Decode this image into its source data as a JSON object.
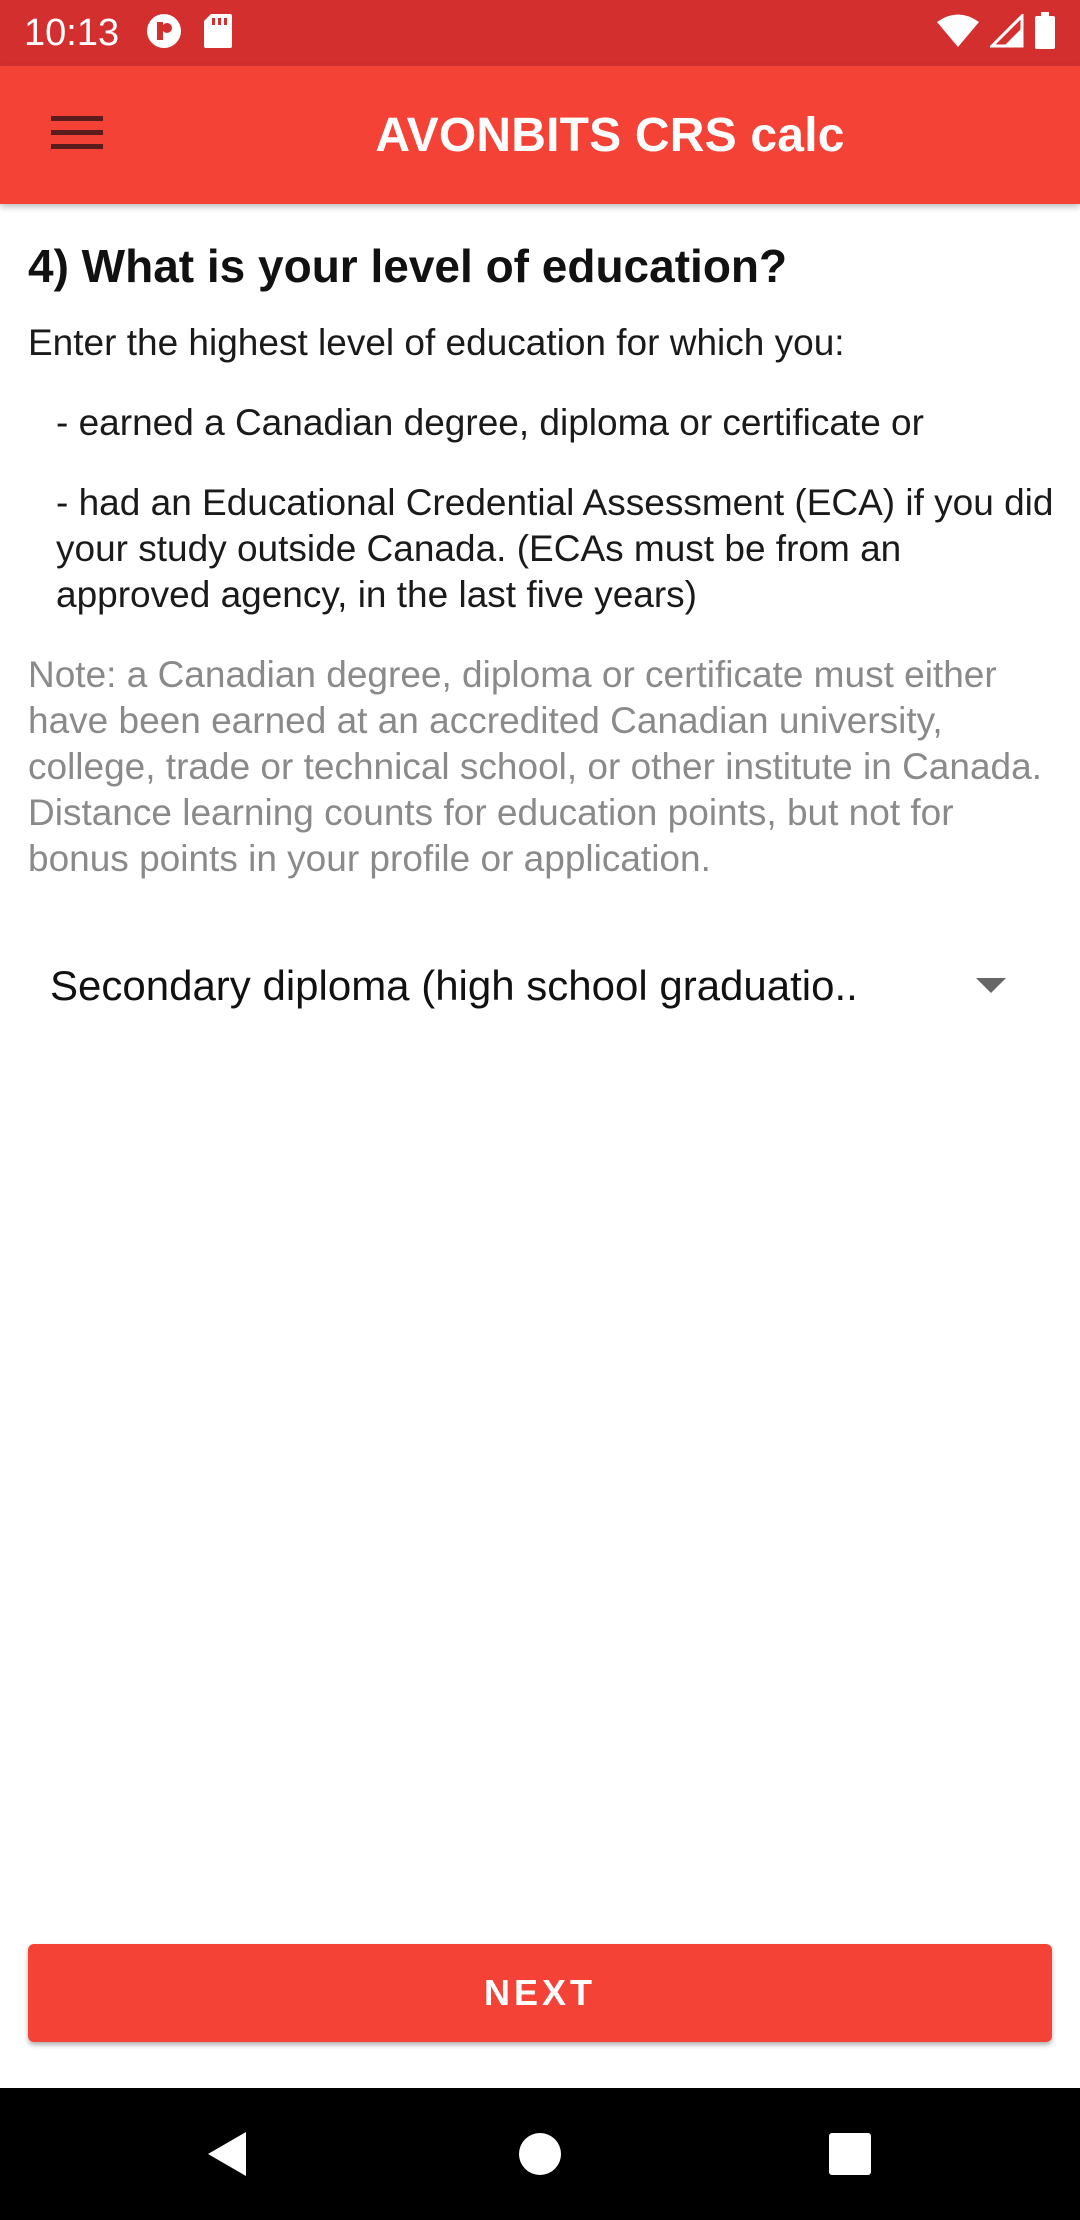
{
  "status_bar": {
    "time": "10:13",
    "left_icons": [
      "app-notification-icon",
      "sd-card-icon"
    ],
    "right_icons": [
      "wifi-icon",
      "cell-signal-icon",
      "battery-icon"
    ]
  },
  "app_bar": {
    "title": "AVONBITS CRS calc",
    "menu_icon": "hamburger-menu-icon"
  },
  "question": {
    "title": "4) What is your level of education?",
    "intro": "Enter the highest level of education for which you:",
    "bullet_1": "- earned a Canadian degree, diploma or certificate or",
    "bullet_2": "- had an Educational Credential Assessment (ECA) if you did your study outside Canada. (ECAs must be from an approved agency, in the last five years)",
    "note": "Note: a Canadian degree, diploma or certificate must either have been earned at an accredited Canadian university, college, trade or technical school, or other institute in Canada. Distance learning counts for education points, but not for bonus points in your profile or application."
  },
  "education_select": {
    "selected": "Secondary diploma (high school graduatio.."
  },
  "next_button": {
    "label": "NEXT"
  },
  "nav_bar": {
    "icons": [
      "back-icon",
      "home-icon",
      "recents-icon"
    ]
  },
  "colors": {
    "status_bar": "#d32f2f",
    "app_bar": "#f44336",
    "button": "#f44336",
    "note_text": "#8a8a8a"
  }
}
